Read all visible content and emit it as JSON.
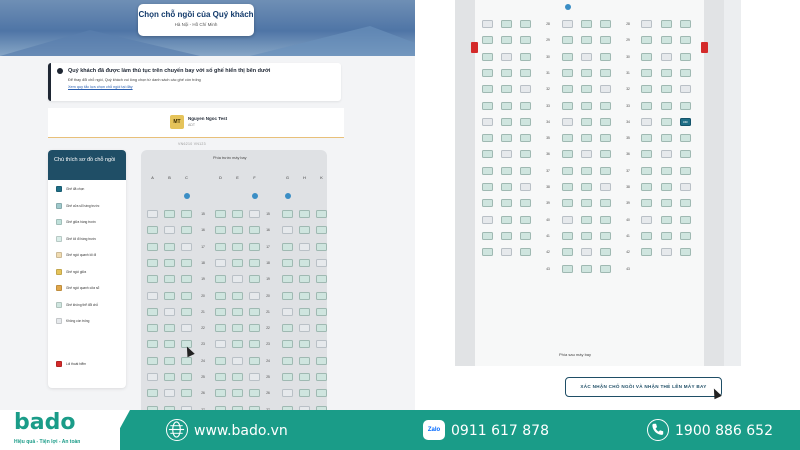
{
  "header": {
    "title": "Chọn chỗ ngồi của Quý khách",
    "route": "Hà Nội - Hồ Chí Minh"
  },
  "notice": {
    "title": "Quý khách đã được làm thủ tục trên chuyến bay với số ghế hiển thị bên dưới",
    "line1": "Để thay đổi chỗ ngồi, Quý khách vui lòng chọn từ danh sách các ghế còn trống",
    "link": "Xem quy tắc lựa chọn chỗ ngồi tại đây"
  },
  "passenger": {
    "initials": "MT",
    "name": "Nguyen Ngoc Test",
    "code": "ADT"
  },
  "flight_note": "VN6210 VN123",
  "legend": {
    "title": "Chú thích sơ đồ chỗ ngồi",
    "items": [
      {
        "label": "Ghế đã chọn",
        "color": "#1f6e86"
      },
      {
        "label": "Ghế cửa sổ hàng trước",
        "color": "#9fc9cc"
      },
      {
        "label": "Ghế giữa hàng trước",
        "color": "#bfe0da"
      },
      {
        "label": "Ghế lối đi hàng trước",
        "color": "#d9ede8"
      },
      {
        "label": "Ghế ngồi quanh lối đi",
        "color": "#f0dbb1"
      },
      {
        "label": "Ghế ngồi giữa",
        "color": "#e5c35a"
      },
      {
        "label": "Ghế ngồi quanh cửa sổ",
        "color": "#e1a74a"
      },
      {
        "label": "Ghế không thể đổi chỗ",
        "color": "#cfe5df"
      },
      {
        "label": "Không còn trống",
        "color": "#e6e9ec"
      },
      {
        "label": "Lối thoát hiểm",
        "color": "#d42a2a"
      }
    ]
  },
  "seatmap_left": {
    "front_label": "Phía trước máy bay",
    "columns": [
      "A",
      "B",
      "C",
      "D",
      "E",
      "F",
      "G",
      "H",
      "K"
    ],
    "rows": [
      "15",
      "16",
      "17",
      "18",
      "19",
      "20",
      "21",
      "22",
      "23",
      "24",
      "25",
      "26",
      "27"
    ]
  },
  "seatmap_right": {
    "rows": [
      "28",
      "29",
      "30",
      "31",
      "32",
      "33",
      "34",
      "35",
      "36",
      "37",
      "38",
      "39",
      "40",
      "41",
      "42",
      "43"
    ],
    "selected_seat": "34F",
    "rear_label": "Phía sau máy bay"
  },
  "confirm_button": "XÁC NHẬN CHỖ NGỒI VÀ NHẬN THẺ LÊN MÁY BAY",
  "footer": {
    "brand": "bado",
    "tagline": "Hiệu quả - Tiện lợi - An toàn",
    "website": "www.bado.vn",
    "zalo_label": "Zalo",
    "zalo_phone": "0911 617 878",
    "hotline": "1900 886 652",
    "icons": [
      "globe-icon",
      "zalo-icon",
      "phone-icon"
    ]
  }
}
